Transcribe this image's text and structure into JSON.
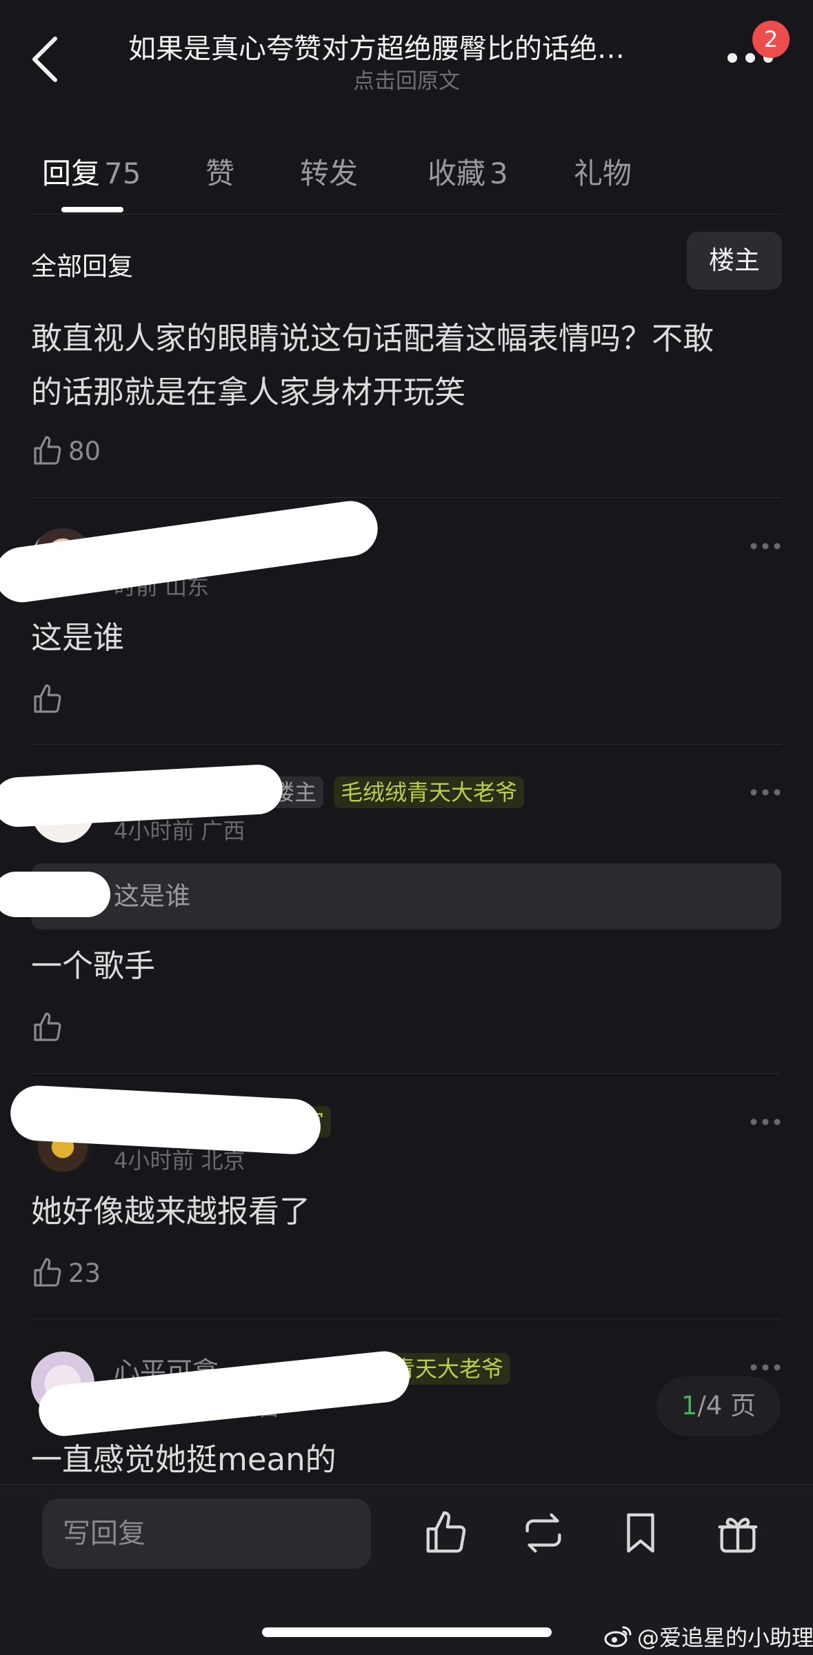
{
  "header": {
    "title": "如果是真心夸赞对方超绝腰臀比的话绝…",
    "subtitle": "点击回原文",
    "badge_count": "2",
    "back_icon": "chevron-left-icon",
    "more_icon": "more-horizontal-icon"
  },
  "tabs": [
    {
      "label": "回复",
      "count": "75",
      "active": true
    },
    {
      "label": "赞",
      "count": "",
      "active": false
    },
    {
      "label": "转发",
      "count": "",
      "active": false
    },
    {
      "label": "收藏",
      "count": "3",
      "active": false
    },
    {
      "label": "礼物",
      "count": "",
      "active": false
    }
  ],
  "section": {
    "all_replies": "全部回复",
    "op_filter": "楼主"
  },
  "comments": [
    {
      "text_line1": "敢直视人家的眼睛说这句话配着这幅表情吗？不敢",
      "text_line2": "的话那就是在拿人家身材开玩笑",
      "likes": "80"
    },
    {
      "meta": "时前 山东",
      "text": "这是谁",
      "likes": ""
    },
    {
      "op_tag": "楼主",
      "badge": "毛绒绒青天大老爷",
      "meta": "4小时前 广西",
      "quote": "这是谁",
      "text": "一个歌手",
      "likes": ""
    },
    {
      "badge_fragment": "官",
      "meta": "4小时前 北京",
      "text": "她好像越来越报看了",
      "likes": "23"
    },
    {
      "name_fragment": "心平可拿",
      "badge": "青天大老爷",
      "meta": "内蒙古",
      "text": "一直感觉她挺mean的",
      "likes": ""
    }
  ],
  "pagination": {
    "current": "1",
    "total_text": "/4 页"
  },
  "bottom_bar": {
    "reply_placeholder": "写回复"
  },
  "watermark": "@爱追星的小助理",
  "colors": {
    "background": "#17171b",
    "badge_red": "#ee4d4d",
    "tag_green": "#bad04a",
    "page_green": "#48b060"
  }
}
